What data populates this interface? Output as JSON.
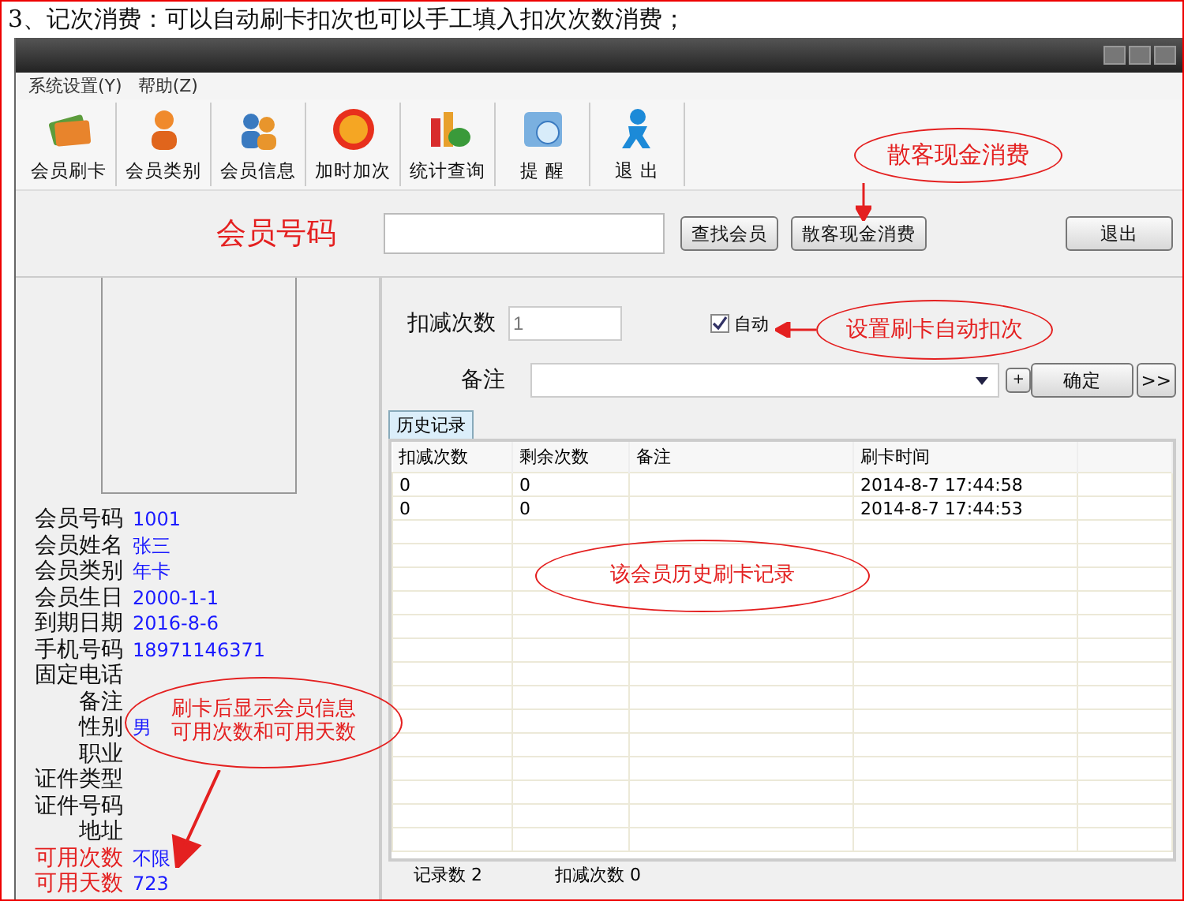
{
  "caption": "3、记次消费：可以自动刷卡扣次也可以手工填入扣次次数消费；",
  "menu": [
    "系统设置(Y)",
    "帮助(Z)"
  ],
  "toolbar": [
    {
      "label": "会员刷卡",
      "kind": "card"
    },
    {
      "label": "会员类别",
      "kind": "person"
    },
    {
      "label": "会员信息",
      "kind": "people"
    },
    {
      "label": "加时加次",
      "kind": "coin"
    },
    {
      "label": "统计查询",
      "kind": "chart"
    },
    {
      "label": "提 醒",
      "kind": "clock"
    },
    {
      "label": "退 出",
      "kind": "exit"
    }
  ],
  "search": {
    "label": "会员号码",
    "buttons": [
      "查找会员",
      "散客现金消费"
    ],
    "exit": "退出"
  },
  "member_fields": [
    {
      "label": "会员号码",
      "value": "1001",
      "highlight": false
    },
    {
      "label": "会员姓名",
      "value": "张三",
      "highlight": false
    },
    {
      "label": "会员类别",
      "value": "年卡",
      "highlight": false
    },
    {
      "label": "会员生日",
      "value": "2000-1-1",
      "highlight": false
    },
    {
      "label": "到期日期",
      "value": "2016-8-6",
      "highlight": false
    },
    {
      "label": "手机号码",
      "value": "18971146371",
      "highlight": false
    },
    {
      "label": "固定电话",
      "highlight": false
    },
    {
      "label": "备注",
      "highlight": false
    },
    {
      "label": "性别",
      "value": "男",
      "highlight": false
    },
    {
      "label": "职业",
      "highlight": false
    },
    {
      "label": "证件类型",
      "highlight": false
    },
    {
      "label": "证件号码",
      "highlight": false
    },
    {
      "label": "地址",
      "highlight": false
    },
    {
      "label": "可用次数",
      "value": "不限",
      "highlight": true
    },
    {
      "label": "可用天数",
      "value": "723",
      "highlight": true
    }
  ],
  "deduct": {
    "label": "扣减次数",
    "value": "1",
    "auto": {
      "label": "自动",
      "checked": true
    },
    "remark_label": "备注",
    "add": "+",
    "confirm": "确定",
    "more": ">>"
  },
  "tabs": [
    {
      "label": "历史记录",
      "selected": true
    }
  ],
  "table": {
    "columns": [
      "扣减次数",
      "剩余次数",
      "备注",
      "刷卡时间"
    ],
    "rows": [
      [
        "0",
        "0",
        "",
        "2014-8-7 17:44:58"
      ],
      [
        "0",
        "0",
        "",
        "2014-8-7 17:44:53"
      ]
    ]
  },
  "status": [
    "记录数 2",
    "扣减次数 0"
  ],
  "callouts": [
    {
      "text": "散客现金消费"
    },
    {
      "text": "设置刷卡自动扣次"
    },
    {
      "text": "该会员历史刷卡记录"
    },
    {
      "lines": [
        "刷卡后显示会员信息",
        "可用次数和可用天数"
      ]
    }
  ]
}
